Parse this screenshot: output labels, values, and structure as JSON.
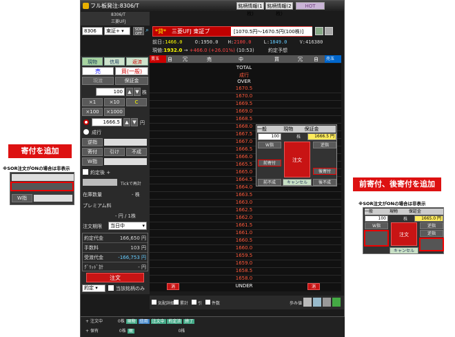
{
  "window": {
    "title": "フル板発注:8306/T",
    "tabs": [
      "銘柄情報(1枚)",
      "銘柄情報(2枚)",
      "HOT"
    ]
  },
  "symbol": {
    "code_top": "8306/T",
    "name_top": "三菱UFJ",
    "code": "8306",
    "market": "東証+",
    "sor": "SOR OFF",
    "badge": "*貸*",
    "name": "三菱UFJ 東証プ",
    "range": "[1070.5円～1670.5円(100株)]"
  },
  "quote": {
    "prev_label": "前日:",
    "prev": "1466.0",
    "open_label": "O:",
    "open": "1950.0",
    "high_label": "H:",
    "high": "2100.0",
    "low_label": "L:",
    "low": "1849.0",
    "vol_label": "V:",
    "vol": "416380",
    "now_label": "現値:",
    "now": "1932.0",
    "arrow": "→",
    "change": "+466.0 (+26.01%)",
    "time": "(10:53)",
    "forecast": "約定予想"
  },
  "tabs": {
    "spot": "現物",
    "margin": "信用",
    "close": "返済"
  },
  "side": {
    "sell": "売",
    "buy": "買(一般)"
  },
  "hold": {
    "h1": "現渡",
    "h2": "保証金"
  },
  "qty": {
    "value": "100",
    "unit": "株",
    "x1": "×1",
    "x10": "×10",
    "clear": "C",
    "x100": "×100",
    "x1000": "×1000"
  },
  "price": {
    "value": "1666.5",
    "unit": "円",
    "market": "成行"
  },
  "cond": {
    "reverse": "逆指",
    "yori": "寄付",
    "hiki": "引け",
    "funari": "不成",
    "w": "W指"
  },
  "cond2": {
    "fixed": "約定後 +",
    "tick": "Tickで再計"
  },
  "info": {
    "stock_label": "在庫数量",
    "stock_val": "- 株",
    "premium_label": "プレミアム料",
    "premium_val": "- 円 / 1株"
  },
  "period": {
    "label": "注文期限",
    "value": "当日中"
  },
  "amounts": [
    {
      "label": "約定代金",
      "value": "166,650 円"
    },
    {
      "label": "手数料",
      "value": "103 円"
    },
    {
      "label": "受渡代金",
      "value": "-166,753 円"
    },
    {
      "label": "ｸﾞﾘｯﾄﾞ計",
      "value": "- 円"
    }
  ],
  "order_btn": "注文",
  "bottom": {
    "select": "約定",
    "check": "当該銘柄のみ"
  },
  "ladder": {
    "headers": [
      "貫玉",
      "自",
      "冗",
      "売",
      "中",
      "買",
      "冗",
      "自",
      "売玉"
    ],
    "total": "TOTAL",
    "market": "成行",
    "over": "OVER",
    "under": "UNDER",
    "cancel": "消",
    "prices": [
      "1670.5",
      "1670.0",
      "1669.5",
      "1669.0",
      "1668.5",
      "1668.0",
      "1667.5",
      "1667.0",
      "1666.5",
      "1666.0",
      "1665.5",
      "1665.0",
      "1664.5",
      "1664.0",
      "1663.5",
      "1663.0",
      "1662.5",
      "1662.0",
      "1661.5",
      "1661.0",
      "1660.5",
      "1660.0",
      "1659.5",
      "1659.0",
      "1658.5",
      "1658.0"
    ]
  },
  "popup": {
    "type": "一般",
    "spot": "現物",
    "guarantee": "保証金",
    "qty": "100",
    "unit": "株",
    "price": "1666.5 円",
    "w": "W指",
    "reverse": "逆指",
    "order": "注文",
    "maeyori": "前寄付",
    "atoyori": "後寄付",
    "zenfunari": "前不成",
    "cancel": "キャンセル",
    "gofunari": "後不成",
    "yori": "寄付",
    "hiki": "引け",
    "funari": "不成"
  },
  "toolbar": {
    "items": [
      "気配詳細",
      "累計",
      "引",
      "件数",
      "歩み値"
    ]
  },
  "status": {
    "row1": [
      "注文中",
      "0株",
      "現物",
      "信用",
      "注文中",
      "約定済",
      "終了"
    ],
    "row2": [
      "保有",
      "0株",
      "現",
      "0株"
    ]
  },
  "left_note": {
    "title": "寄付を追加",
    "note": "※SOR注文がONの場合は非表示",
    "w": "W指"
  },
  "right_note": {
    "title": "前寄付、後寄付を追加",
    "note": "※SOR注文がONの場合は非表示",
    "type": "一般",
    "spot": "現物",
    "guarantee": "保証金",
    "qty": "100",
    "unit": "株",
    "price": "1665.0 円",
    "w": "W指",
    "reverse": "逆指",
    "order": "注文",
    "cancel": "キャンセル"
  }
}
